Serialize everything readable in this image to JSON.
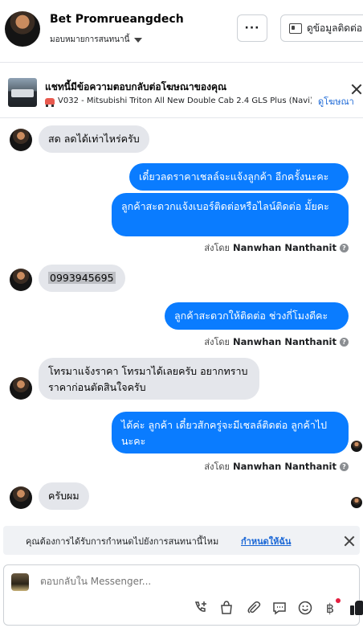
{
  "header": {
    "contact_name": "Bet Promrueangdech",
    "assign_label": "มอบหมายการสนทนานี้",
    "more_label": "···",
    "contact_info_label": "ดูข้อมูลติดต่อ"
  },
  "ad_banner": {
    "title": "แชทนี้มีข้อความตอบกลับต่อโฆษณาของคุณ",
    "subtitle": "V032 - Mitsubishi Triton All New Double Cab 2.4 GLS Plus (Navi) ...",
    "view_ad_label": "ดูโฆษณา"
  },
  "messages": [
    {
      "direction": "in",
      "text": "สด ลดได้เท่าไหร่ครับ"
    },
    {
      "direction": "out",
      "text": "เดี๋ยวลดราคาเชลล์จะแจ้งลูกค้า อีกครั้งนะคะ"
    },
    {
      "direction": "out",
      "text": "ลูกค้าสะดวกแจ้งเบอร์ติดต่อหรือไลน์ติดต่อ มั้ยคะ"
    },
    {
      "direction": "in",
      "text": "0993945695"
    },
    {
      "direction": "out",
      "text": "ลูกค้าสะดวกให้ติดต่อ ช่วงกี่โมงดีคะ"
    },
    {
      "direction": "in",
      "text": "โทรมาแจ้งราคา โทรมาได้เลยครับ อยากทราบราคาก่อนตัดสินใจครับ"
    },
    {
      "direction": "out",
      "text": "ได้ค่ะ  ลูกค้า  เดี๋ยวสักครู่จะมีเชลล์ติดต่อ ลูกค้าไปนะคะ"
    },
    {
      "direction": "in",
      "text": "ครับผม"
    }
  ],
  "sent_by": {
    "prefix": "ส่งโดย",
    "name": "Nanwhan Nanthanit",
    "help_icon": "?"
  },
  "prompt": {
    "text": "คุณต้องการได้รับการกำหนดไปยังการสนทนานี้ไหม",
    "link": "กำหนดให้ฉัน"
  },
  "composer": {
    "placeholder": "ตอบกลับใน Messenger..."
  },
  "icons": {
    "baht_symbol": "฿"
  },
  "colors": {
    "outgoing_bubble": "#0a7cff",
    "incoming_bubble": "#e4e6eb",
    "link": "#1a67d6"
  }
}
